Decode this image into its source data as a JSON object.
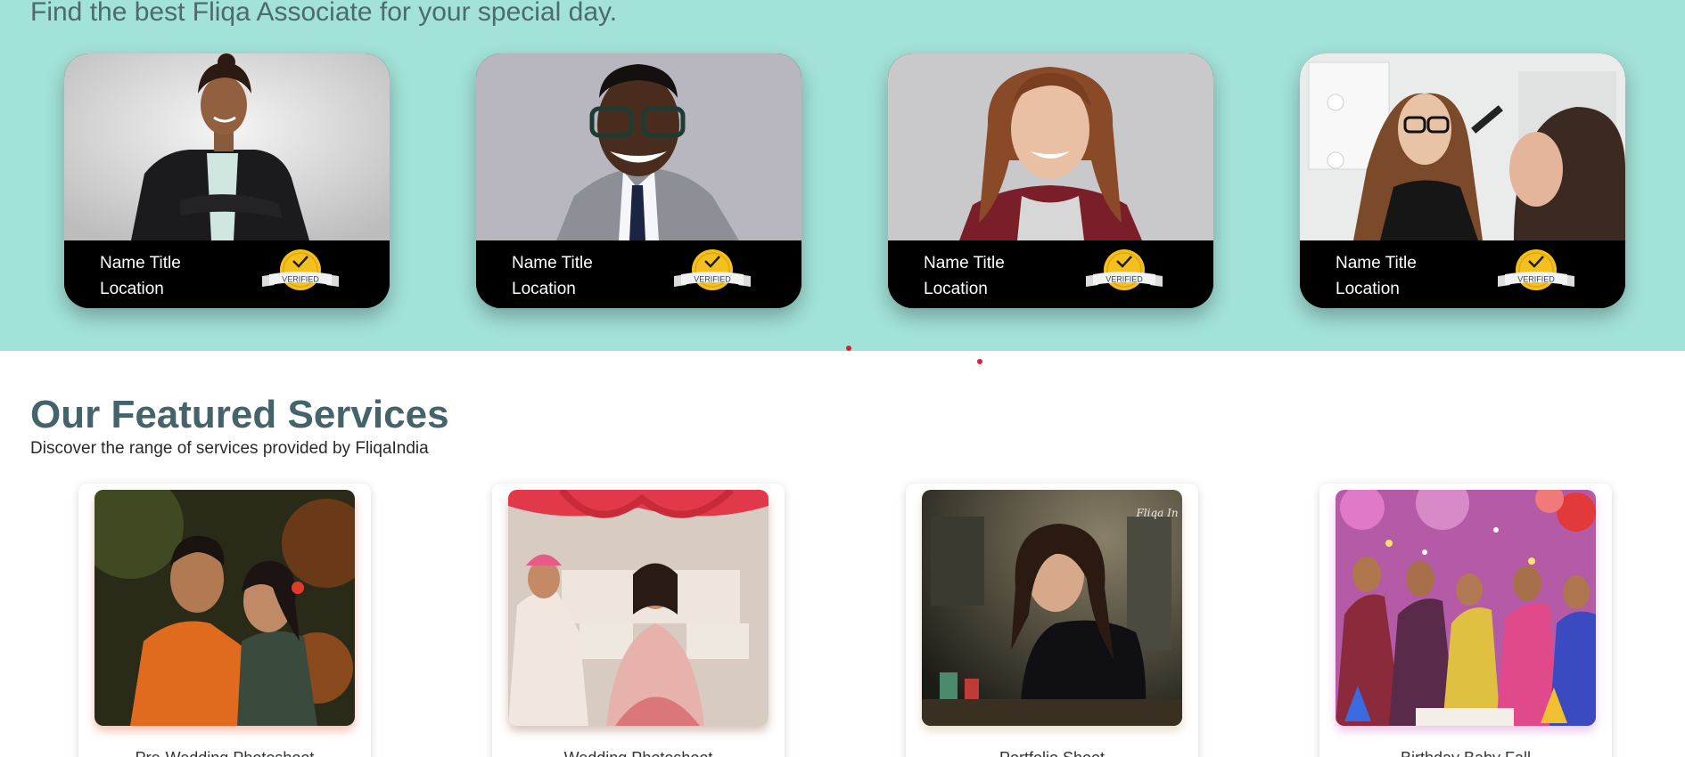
{
  "associates": {
    "tagline": "Find the best Fliqa Associate for your special day.",
    "badge_text": "VERIFIED",
    "cards": [
      {
        "name": "Name Title",
        "location": "Location",
        "photo": "woman-in-black-blazer-photo"
      },
      {
        "name": "Name Title",
        "location": "Location",
        "photo": "smiling-man-in-glasses-photo"
      },
      {
        "name": "Name Title",
        "location": "Location",
        "photo": "smiling-woman-photo"
      },
      {
        "name": "Name Title",
        "location": "Location",
        "photo": "makeup-artist-photo"
      }
    ]
  },
  "services": {
    "title": "Our Featured Services",
    "subtitle": "Discover the range of services provided by FliqaIndia",
    "cards": [
      {
        "label": "Pre-Wedding Photoshoot",
        "photo": "couple-pre-wedding-photo"
      },
      {
        "label": "Wedding Photoshoot",
        "photo": "wedding-ceremony-photo"
      },
      {
        "label": "Portfolio Shoot",
        "photo": "woman-portrait-photo"
      },
      {
        "label": "Birthday Baby Fall",
        "photo": "birthday-celebration-photo"
      }
    ],
    "watermark": "Fliqa In"
  },
  "colors": {
    "band": "#a2e2d8",
    "title": "#44636a",
    "dot": "#d5242b",
    "badge_gold": "#f4c01e"
  }
}
